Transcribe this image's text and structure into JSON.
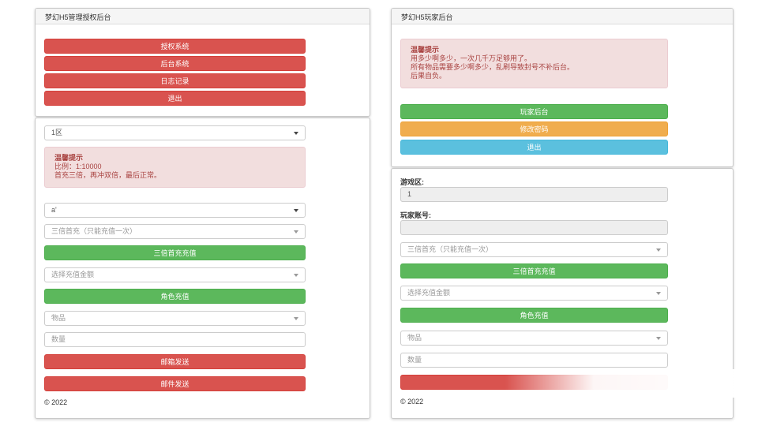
{
  "left": {
    "top_panel": {
      "title": "梦幻H5管理授权后台",
      "buttons": [
        "授权系统",
        "后台系统",
        "日志记录",
        "退出"
      ]
    },
    "form": {
      "server_select": "1区",
      "alert": {
        "title": "温馨提示",
        "lines": [
          "比例：1:10000",
          "首充三倍，再冲双倍，最后正常。"
        ]
      },
      "account_select": "a'",
      "triple_select_placeholder": "三倍首充（只能充值一次）",
      "triple_button": "三倍首充充值",
      "amount_select_placeholder": "选择充值金额",
      "recharge_button": "角色充值",
      "item_select_placeholder": "物品",
      "quantity_placeholder": "数量",
      "send_item_button": "邮箱发送",
      "mail_button": "邮件发送",
      "copyright": "© 2022"
    }
  },
  "right": {
    "top_panel": {
      "title": "梦幻H5玩家后台",
      "alert": {
        "title": "温馨提示",
        "lines": [
          "用多少啊多少，一次几千万足够用了。",
          "所有物品需要多少啊多少，乱刷导致封号不补后台。",
          "后果自负。"
        ]
      },
      "buttons": [
        {
          "label": "玩家后台",
          "color": "#5cb85c"
        },
        {
          "label": "修改密码",
          "color": "#f0ad4e"
        },
        {
          "label": "退出",
          "color": "#5bc0de"
        }
      ]
    },
    "form": {
      "zone_label": "游戏区:",
      "zone_value": "1",
      "account_label": "玩家账号:",
      "triple_select_placeholder": "三倍首充（只能充值一次）",
      "triple_button": "三倍首充充值",
      "amount_select_placeholder": "选择充值金额",
      "recharge_button": "角色充值",
      "item_select_placeholder": "物品",
      "quantity_placeholder": "数量",
      "copyright": "© 2022"
    }
  }
}
